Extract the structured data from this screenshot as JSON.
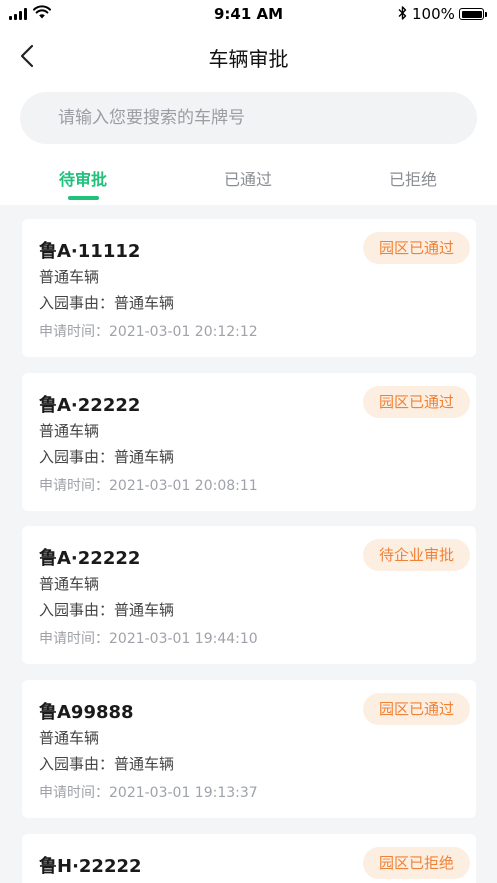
{
  "status_bar": {
    "time": "9:41 AM",
    "battery": "100%"
  },
  "nav": {
    "title": "车辆审批"
  },
  "search": {
    "placeholder": "请输入您要搜索的车牌号",
    "value": ""
  },
  "tabs": [
    {
      "label": "待审批",
      "active": true
    },
    {
      "label": "已通过",
      "active": false
    },
    {
      "label": "已拒绝",
      "active": false
    }
  ],
  "colors": {
    "accent": "#1fc17b",
    "badge_text": "#f08236",
    "badge_bg": "#fdeee2"
  },
  "records": [
    {
      "plate": "鲁A·11112",
      "type": "普通车辆",
      "reason": "入园事由：普通车辆",
      "time": "申请时间：2021-03-01 20:12:12",
      "status": "园区已通过"
    },
    {
      "plate": "鲁A·22222",
      "type": "普通车辆",
      "reason": "入园事由：普通车辆",
      "time": "申请时间：2021-03-01 20:08:11",
      "status": "园区已通过"
    },
    {
      "plate": "鲁A·22222",
      "type": "普通车辆",
      "reason": "入园事由：普通车辆",
      "time": "申请时间：2021-03-01 19:44:10",
      "status": "待企业审批"
    },
    {
      "plate": "鲁A99888",
      "type": "普通车辆",
      "reason": "入园事由：普通车辆",
      "time": "申请时间：2021-03-01 19:13:37",
      "status": "园区已通过"
    },
    {
      "plate": "鲁H·22222",
      "type": "",
      "reason": "",
      "time": "",
      "status": "园区已拒绝"
    }
  ]
}
